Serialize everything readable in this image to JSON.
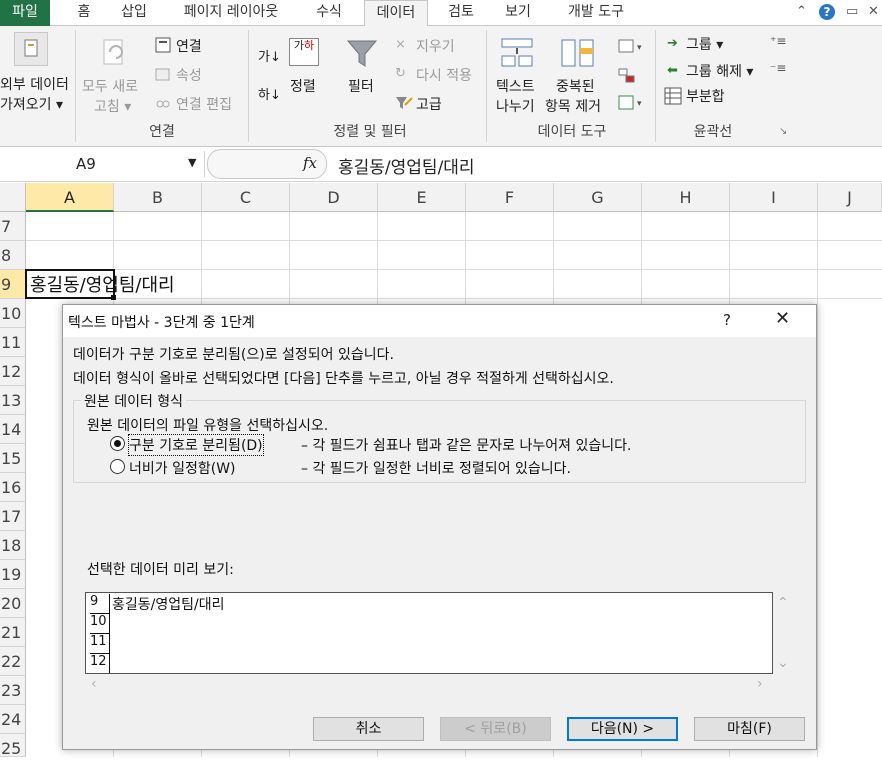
{
  "tabs": [
    "파일",
    "홈",
    "삽입",
    "페이지 레이아웃",
    "수식",
    "데이터",
    "검토",
    "보기",
    "개발 도구"
  ],
  "ribbon": {
    "get_external": [
      "외부 데이터",
      "가져오기 ▾"
    ],
    "refresh_all": [
      "모두 새로",
      "고침 ▾"
    ],
    "connections": "연결",
    "properties": "속성",
    "edit_links": "연결 편집",
    "group_connections": "연결",
    "sort": "정렬",
    "filter": "필터",
    "clear": "지우기",
    "reapply": "다시 적용",
    "advanced": "고급",
    "group_sort_filter": "정렬 및 필터",
    "text_to_columns": [
      "텍스트",
      "나누기"
    ],
    "remove_duplicates": [
      "중복된",
      "항목 제거"
    ],
    "group_data_tools": "데이터 도구",
    "group": "그룹 ▾",
    "ungroup": "그룹 해제 ▾",
    "subtotal": "부분합",
    "group_outline": "윤곽선",
    "sort_az_icon": "가↓",
    "sort_za_icon": "하↓",
    "sort_icon_text": [
      "가",
      "하"
    ]
  },
  "formula_bar": {
    "name_box": "A9",
    "fx": "fx",
    "formula": "홍길동/영업팀/대리"
  },
  "columns": [
    "A",
    "B",
    "C",
    "D",
    "E",
    "F",
    "G",
    "H",
    "I",
    "J"
  ],
  "rows": [
    "7",
    "8",
    "9",
    "10",
    "11",
    "12",
    "13",
    "14",
    "15",
    "16",
    "17",
    "18",
    "19",
    "20",
    "21",
    "22",
    "23",
    "24",
    "25"
  ],
  "cell_a9": "홍길동/영업팀/대리",
  "dialog": {
    "title": "텍스트 마법사 - 3단계 중 1단계",
    "help": "?",
    "close": "✕",
    "line1": "데이터가 구분 기호로 분리됨(으)로 설정되어 있습니다.",
    "line2": "데이터 형식이 올바로 선택되었다면 [다음] 단추를 누르고, 아닐 경우 적절하게 선택하십시오.",
    "group_title": "원본 데이터 형식",
    "group_prompt": "원본 데이터의 파일 유형을 선택하십시오.",
    "option1_label": "구분 기호로 분리됨(D)",
    "option1_desc": "– 각 필드가 쉼표나 탭과 같은 문자로 나누어져 있습니다.",
    "option2_label": "너비가 일정함(W)",
    "option2_desc": "– 각 필드가 일정한 너비로 정렬되어 있습니다.",
    "preview_label": "선택한 데이터 미리 보기:",
    "preview_rows": [
      {
        "num": "9",
        "value": "홍길동/영업팀/대리"
      },
      {
        "num": "10",
        "value": ""
      },
      {
        "num": "11",
        "value": ""
      },
      {
        "num": "12",
        "value": ""
      }
    ],
    "buttons": {
      "cancel": "취소",
      "back": "< 뒤로(B)",
      "next": "다음(N) >",
      "finish": "마침(F)"
    }
  },
  "colors": {
    "file_tab": "#217346",
    "selection_header": "#ffe9a8",
    "primary_button_border": "#0078d7"
  }
}
